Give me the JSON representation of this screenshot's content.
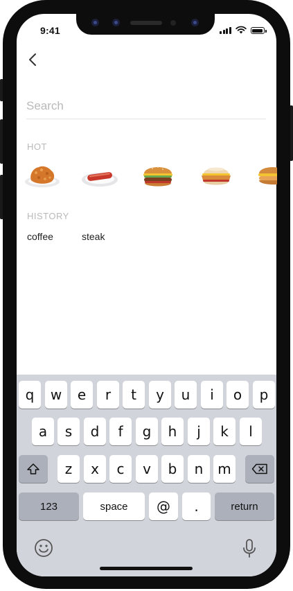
{
  "status_bar": {
    "time": "9:41"
  },
  "search": {
    "placeholder": "Search",
    "value": ""
  },
  "hot": {
    "title": "HOT",
    "items": [
      {
        "name": "fried-chicken"
      },
      {
        "name": "sausage-plate"
      },
      {
        "name": "burger"
      },
      {
        "name": "chicken-muffin"
      },
      {
        "name": "bagel-sandwich"
      }
    ]
  },
  "history": {
    "title": "HISTORY",
    "items": [
      "coffee",
      "steak"
    ]
  },
  "keyboard": {
    "row1": [
      "q",
      "w",
      "e",
      "r",
      "t",
      "y",
      "u",
      "i",
      "o",
      "p"
    ],
    "row2": [
      "a",
      "s",
      "d",
      "f",
      "g",
      "h",
      "j",
      "k",
      "l"
    ],
    "row3": [
      "z",
      "x",
      "c",
      "v",
      "b",
      "n",
      "m"
    ],
    "numbers_label": "123",
    "space_label": "space",
    "at_label": "@",
    "dot_label": ".",
    "return_label": "return"
  },
  "colors": {
    "accent": "#111111",
    "muted": "#b9b9b9",
    "keyboard_bg": "#d1d4da",
    "dark_key": "#abb0bb"
  }
}
